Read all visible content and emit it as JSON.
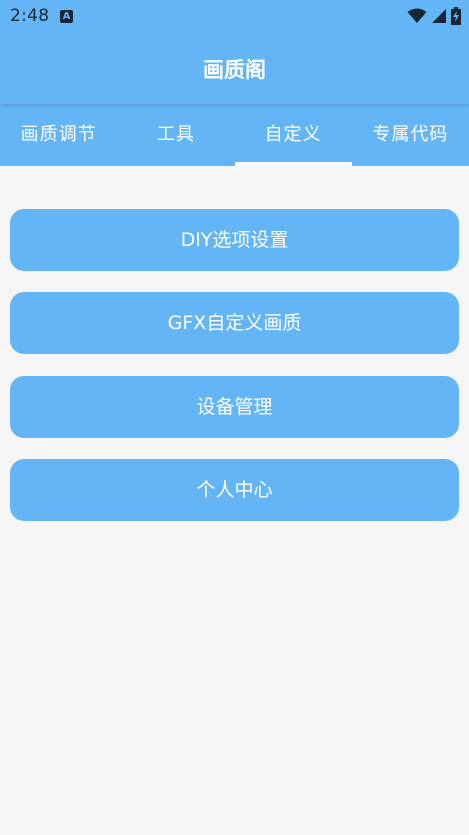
{
  "status_bar": {
    "time": "2:48",
    "notification_icon": "A"
  },
  "app_bar": {
    "title": "画质阁"
  },
  "tabs": [
    {
      "label": "画质调节",
      "active": false
    },
    {
      "label": "工具",
      "active": false
    },
    {
      "label": "自定义",
      "active": true
    },
    {
      "label": "专属代码",
      "active": false
    }
  ],
  "menu": [
    {
      "label": "DIY选项设置"
    },
    {
      "label": "GFX自定义画质"
    },
    {
      "label": "设备管理"
    },
    {
      "label": "个人中心"
    }
  ],
  "colors": {
    "primary": "#64b5f6",
    "background": "#f5f5f5",
    "text_on_primary": "#ffffff",
    "status_icons": "#1a2633"
  }
}
